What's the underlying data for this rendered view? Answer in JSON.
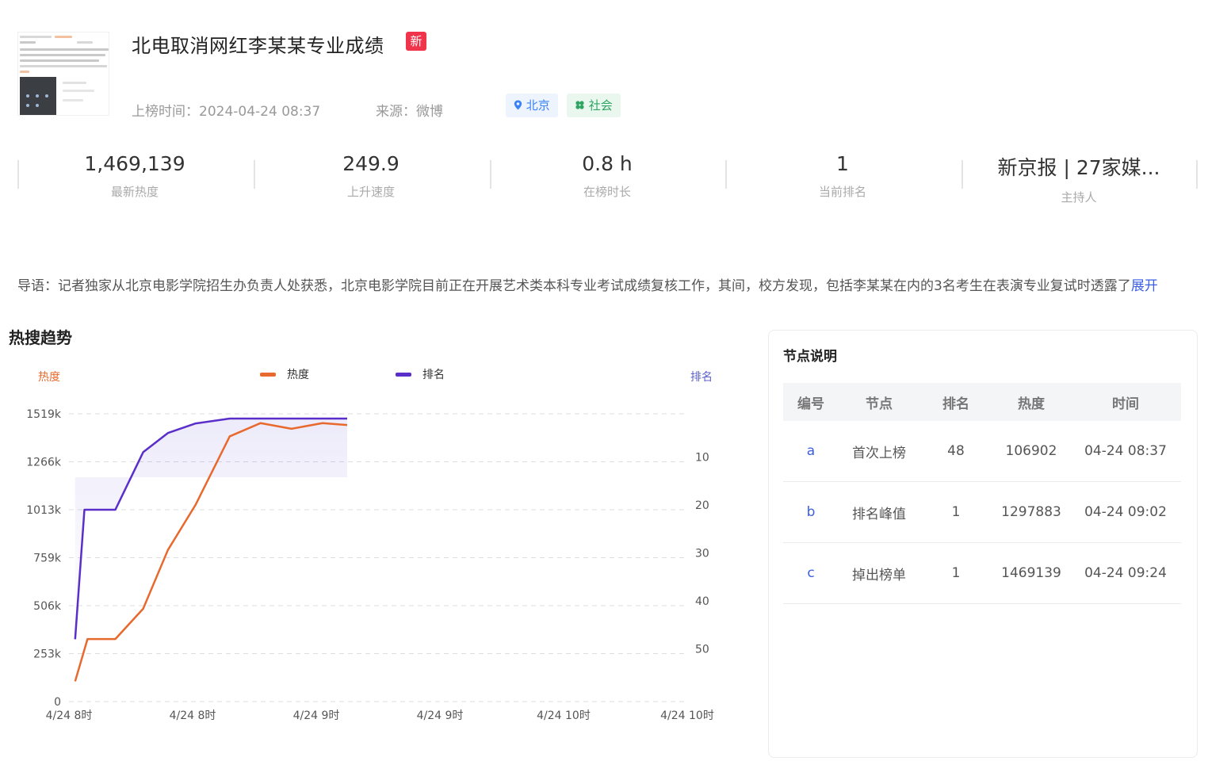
{
  "header": {
    "title": "北电取消网红李某某专业成绩",
    "new_badge": "新",
    "time_label": "上榜时间：2024-04-24 08:37",
    "source_label": "来源：微博",
    "tag_location": "北京",
    "tag_category": "社会"
  },
  "stats": [
    {
      "value": "1,469,139",
      "label": "最新热度"
    },
    {
      "value": "249.9",
      "label": "上升速度"
    },
    {
      "value": "0.8 h",
      "label": "在榜时长"
    },
    {
      "value": "1",
      "label": "当前排名"
    },
    {
      "value": "新京报 | 27家媒...",
      "label": "主持人"
    }
  ],
  "intro": {
    "text": "导语：记者独家从北京电影学院招生办负责人处获悉，北京电影学院目前正在开展艺术类本科专业考试成绩复核工作，其间，校方发现，包括李某某在内的3名考生在表演专业复试时透露了",
    "more": "展开"
  },
  "trend": {
    "section_title": "热搜趋势"
  },
  "chart_data": {
    "type": "line",
    "left_axis_label": "热度",
    "right_axis_label": "排名",
    "legend": [
      {
        "name": "热度",
        "color": "#e8692d"
      },
      {
        "name": "排名",
        "color": "#5a2fc9"
      }
    ],
    "legend_position": "top-center",
    "grid": true,
    "y_left_ticks": [
      "1519k",
      "1266k",
      "1013k",
      "759k",
      "506k",
      "253k",
      "0"
    ],
    "y_left_range": [
      0,
      1519000
    ],
    "y_right_ticks": [
      "10",
      "20",
      "30",
      "40",
      "50"
    ],
    "y_right_range": [
      1,
      61
    ],
    "y_right_inverted": true,
    "x_tick_labels": [
      "4/24 8时",
      "4/24 8时",
      "4/24 9时",
      "4/24 9时",
      "4/24 10时",
      "4/24 10时"
    ],
    "x_range_minutes": [
      0,
      100
    ],
    "series": [
      {
        "name": "热度",
        "axis": "left",
        "x": [
          1,
          3,
          7.5,
          12,
          16,
          20.5,
          26,
          31,
          36,
          41,
          45
        ],
        "values": [
          106902,
          330000,
          330000,
          490000,
          800000,
          1040000,
          1400000,
          1470000,
          1440000,
          1470000,
          1460000
        ]
      },
      {
        "name": "排名",
        "axis": "left",
        "x": [
          1,
          2.5,
          7.5,
          12,
          16,
          20.5,
          26,
          45
        ],
        "values": [
          48,
          21,
          21,
          9,
          5,
          3,
          2,
          2
        ]
      }
    ]
  },
  "nodes": {
    "title": "节点说明",
    "columns": [
      "编号",
      "节点",
      "排名",
      "热度",
      "时间"
    ],
    "rows": [
      {
        "id": "a",
        "node": "首次上榜",
        "rank": "48",
        "heat": "106902",
        "time": "04-24 08:37"
      },
      {
        "id": "b",
        "node": "排名峰值",
        "rank": "1",
        "heat": "1297883",
        "time": "04-24 09:02"
      },
      {
        "id": "c",
        "node": "掉出榜单",
        "rank": "1",
        "heat": "1469139",
        "time": "04-24 09:24"
      }
    ]
  }
}
